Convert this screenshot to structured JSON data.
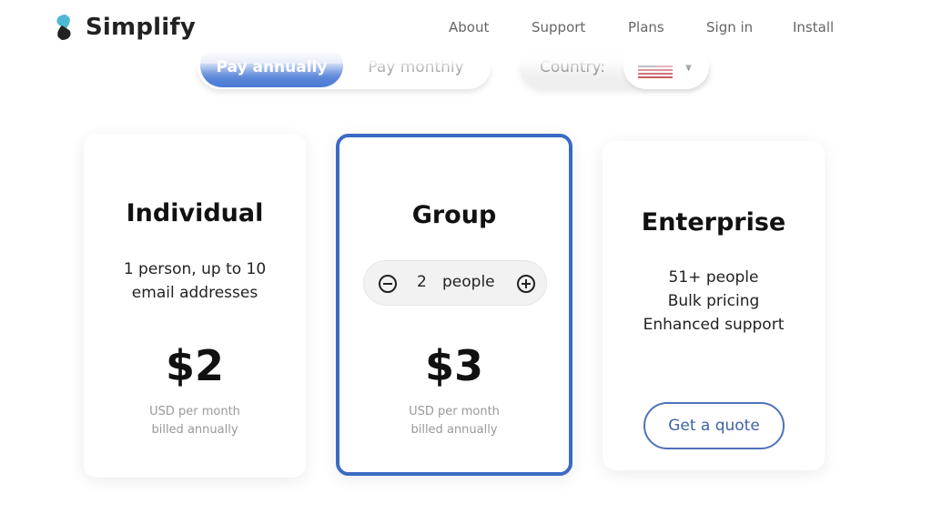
{
  "header": {
    "brand": "Simplify",
    "nav": [
      {
        "label": "About"
      },
      {
        "label": "Support"
      },
      {
        "label": "Plans"
      },
      {
        "label": "Sign in"
      },
      {
        "label": "Install"
      }
    ]
  },
  "controls": {
    "billing": {
      "options": [
        {
          "label": "Pay annually",
          "selected": true
        },
        {
          "label": "Pay monthly",
          "selected": false
        }
      ]
    },
    "country": {
      "label": "Country:",
      "selected": "United States",
      "flag_icon": "us-flag-icon"
    }
  },
  "colors": {
    "accent": "#4f7dd6",
    "selected_border": "#3a6bc4",
    "quote_button": "#4f72b8"
  },
  "plans": [
    {
      "name": "Individual",
      "description": [
        "1 person, up to 10",
        "email addresses"
      ],
      "price": "$2",
      "price_note": [
        "USD per month",
        "billed annually"
      ]
    },
    {
      "name": "Group",
      "stepper": {
        "count": "2",
        "unit": "people"
      },
      "price": "$3",
      "price_note": [
        "USD per month",
        "billed annually"
      ],
      "selected": true
    },
    {
      "name": "Enterprise",
      "description": [
        "51+ people",
        "Bulk pricing",
        "Enhanced support"
      ],
      "cta": "Get a quote"
    }
  ]
}
